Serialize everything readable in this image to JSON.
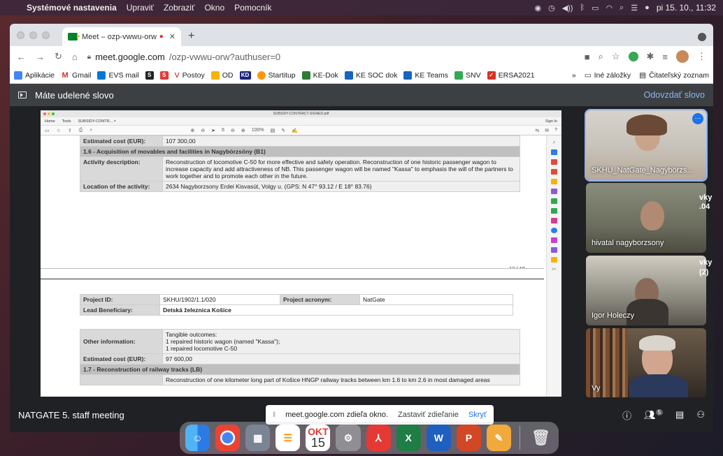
{
  "menubar": {
    "app": "Systémové nastavenia",
    "items": [
      "Upraviť",
      "Zobraziť",
      "Okno",
      "Pomocník"
    ],
    "clock": "pi 15. 10., 11:32"
  },
  "browser": {
    "tab_title": "Meet – ozp-vwwu-orw",
    "url_host": "meet.google.com",
    "url_path": "/ozp-vwwu-orw?authuser=0",
    "bookmarks": [
      "Aplikácie",
      "Gmail",
      "EVS mail",
      "Postoy",
      "OD",
      "Startitup",
      "KE-Dok",
      "KE SOC dok",
      "KE Teams",
      "SNV",
      "ERSA2021"
    ],
    "bookmarks_right": [
      "Iné záložky",
      "Čitateľský zoznam"
    ]
  },
  "meet": {
    "banner": "Máte udelené slovo",
    "revoke": "Odovzdať slovo",
    "meeting_name": "NATGATE 5. staff meeting",
    "share_msg": "meet.google.com zdieľa okno.",
    "stop_share": "Zastaviť zdieľanie",
    "hide": "Skryť",
    "participants_count": "5",
    "tiles": [
      {
        "name": "SKHU_NatGate_Nagybörzs..."
      },
      {
        "name": "hivatal nagyborzsony"
      },
      {
        "name": "Igor Holeczy"
      },
      {
        "name": "Vy"
      }
    ],
    "side_peek": [
      "vky",
      ".04",
      "vky",
      "(2)"
    ]
  },
  "pdf": {
    "window_title": "SUBSIDY-CONTRACT-SIGNED.pdf",
    "tabs": [
      "Home",
      "Tools",
      "SUBSIDY-CONTR... ×"
    ],
    "signin": "Sign In",
    "page_indicator": "13 / 19",
    "zoom": "100%",
    "top": {
      "est_cost_label": "Estimated cost (EUR):",
      "est_cost_value": "107 300,00",
      "section_header": "1.6 - Acquisition of movables and facilities in Nagybörzsöny (B1)",
      "activity_label": "Activity description:",
      "activity_value": "Reconstruction of locomotive C-50 for more effective and safety operation. Reconstruction of one historic passenger wagon to increase capacity and add attractiveness of NB. This passenger wagon will be named \"Kassa\" to emphasis the will of the partners to work together and to promote each other in the future.",
      "location_label": "Location of the activity:",
      "location_value": "2634 Nagyborzsony Erdei Kisvasút, Volgy u. (GPS: N 47° 93.12 / E 18° 83.76)"
    },
    "bottom": {
      "project_id_label": "Project ID:",
      "project_id_value": "SKHU/1902/1.1/020",
      "acronym_label": "Project acronym:",
      "acronym_value": "NatGate",
      "lead_label": "Lead Beneficiary:",
      "lead_value": "Detská železnica Košice",
      "other_label": "Other information:",
      "other_lines": [
        "Tangible outcomes:",
        "1 repaired historic wagon (named \"Kassa\");",
        "1 repaired locomotive C-50"
      ],
      "est_label": "Estimated cost (EUR):",
      "est_value": "97 600,00",
      "section2": "1.7 - Reconstruction of railway tracks (LB)",
      "cut_text": "Reconstruction of one kilometer long part of Košice HNGP railway tracks between km 1.6 to km 2.6 in most damaged areas"
    }
  },
  "dock": {
    "calendar_month": "OKT",
    "calendar_day": "15"
  }
}
